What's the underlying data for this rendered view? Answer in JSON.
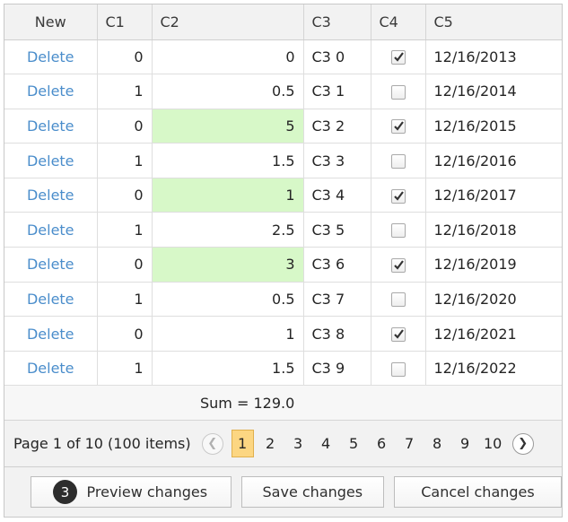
{
  "columns": [
    "New",
    "C1",
    "C2",
    "C3",
    "C4",
    "C5"
  ],
  "rows": [
    {
      "action": "Delete",
      "c1": "0",
      "c2": "0",
      "c3": "C3 0",
      "c4": true,
      "c5": "12/16/2013",
      "c2_modified": false
    },
    {
      "action": "Delete",
      "c1": "1",
      "c2": "0.5",
      "c3": "C3 1",
      "c4": false,
      "c5": "12/16/2014",
      "c2_modified": false
    },
    {
      "action": "Delete",
      "c1": "0",
      "c2": "5",
      "c3": "C3 2",
      "c4": true,
      "c5": "12/16/2015",
      "c2_modified": true
    },
    {
      "action": "Delete",
      "c1": "1",
      "c2": "1.5",
      "c3": "C3 3",
      "c4": false,
      "c5": "12/16/2016",
      "c2_modified": false
    },
    {
      "action": "Delete",
      "c1": "0",
      "c2": "1",
      "c3": "C3 4",
      "c4": true,
      "c5": "12/16/2017",
      "c2_modified": true
    },
    {
      "action": "Delete",
      "c1": "1",
      "c2": "2.5",
      "c3": "C3 5",
      "c4": false,
      "c5": "12/16/2018",
      "c2_modified": false
    },
    {
      "action": "Delete",
      "c1": "0",
      "c2": "3",
      "c3": "C3 6",
      "c4": true,
      "c5": "12/16/2019",
      "c2_modified": true
    },
    {
      "action": "Delete",
      "c1": "1",
      "c2": "0.5",
      "c3": "C3 7",
      "c4": false,
      "c5": "12/16/2020",
      "c2_modified": false
    },
    {
      "action": "Delete",
      "c1": "0",
      "c2": "1",
      "c3": "C3 8",
      "c4": true,
      "c5": "12/16/2021",
      "c2_modified": false
    },
    {
      "action": "Delete",
      "c1": "1",
      "c2": "1.5",
      "c3": "C3 9",
      "c4": false,
      "c5": "12/16/2022",
      "c2_modified": false
    }
  ],
  "summary": {
    "text": "Sum = 129.0"
  },
  "pager": {
    "summary_text": "Page 1 of 10 (100 items)",
    "current_page": "1",
    "pages": [
      "1",
      "2",
      "3",
      "4",
      "5",
      "6",
      "7",
      "8",
      "9",
      "10"
    ],
    "prev_icon": "chevron-left-icon",
    "next_icon": "chevron-right-icon"
  },
  "footer": {
    "preview_label": "Preview changes",
    "preview_badge": "3",
    "save_label": "Save changes",
    "cancel_label": "Cancel changes"
  },
  "colors": {
    "link": "#4a8dcb",
    "modified_cell": "#d7f8c8",
    "active_page": "#fcd682",
    "badge": "#2d2d2d"
  }
}
